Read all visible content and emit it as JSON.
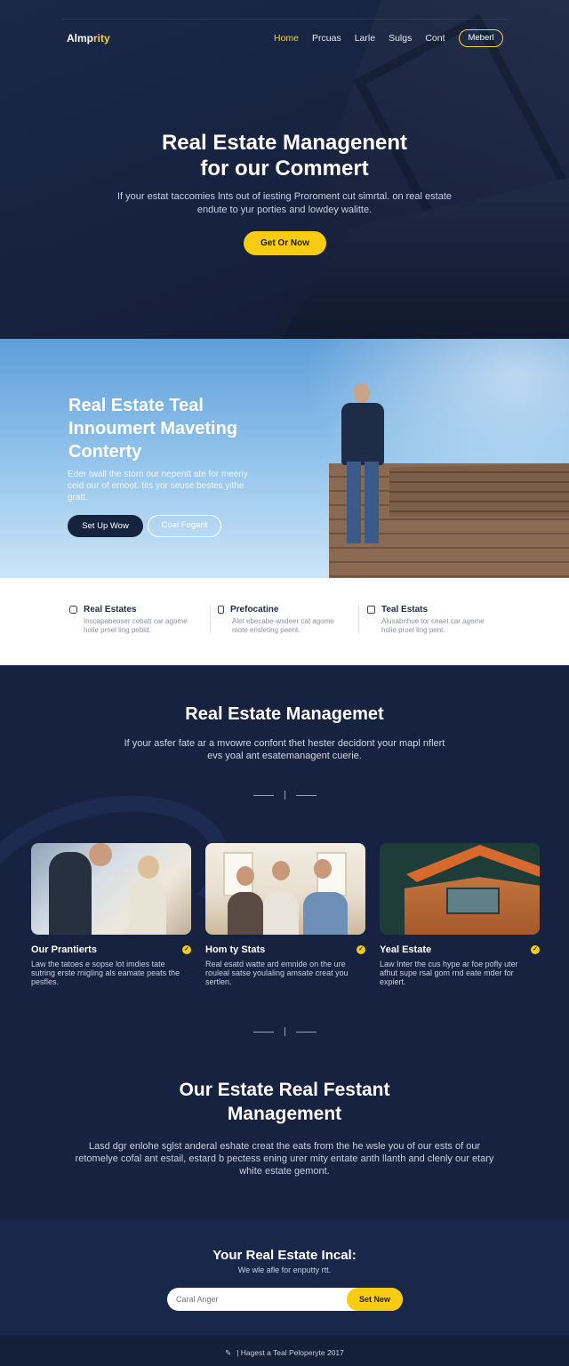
{
  "brand": {
    "logo_prefix": "Almp",
    "logo_suffix": "rity"
  },
  "nav": {
    "items": [
      "Home",
      "Prcuas",
      "Larle",
      "Sulgs",
      "Cont"
    ],
    "cta": "Meberl"
  },
  "hero": {
    "title_line1": "Real Estate Managenent",
    "title_line2": "for our Commert",
    "subtitle": "If your estat taccomies lnts out of iesting Proroment cut simrtal. on real estate endute to yur porties and lowdey walitte.",
    "cta": "Get Or Now"
  },
  "promo": {
    "title": "Real Estate Teal Innoumert Maveting Conterty",
    "subtitle": "Eder twall the storn our nepentt ate for meeriy ceid our of ernoot. tits yor seuse bestes yithe gratt.",
    "primary_button": "Set Up Wow",
    "secondary_button": "Coal Fogant"
  },
  "features": [
    {
      "title": "Real Estates",
      "desc": "Inscapabeoser cebatt car agome holie prnel ling pebld."
    },
    {
      "title": "Prefocatine",
      "desc": "Alet ebecabe-wsdeer cat agome mote ensleting peent."
    },
    {
      "title": "Teal Estats",
      "desc": "Alusabnhue tor ceaet car ageme holie proel ling pent."
    }
  ],
  "management": {
    "title": "Real Estate Managemet",
    "subtitle": "If your asfer fate ar a mvowre confont thet hester decidont your mapl nflert evs yoal ant esatemanagent cuerie."
  },
  "cards": [
    {
      "title": "Our Prantierts",
      "desc": "Law the tatoes e sopse lot imdies tate sutring erste rnigling als eamate peats the pesfles."
    },
    {
      "title": "Hom ty Stats",
      "desc": "Real esatd watte ard emnide on the ure rouleal satse youlaling amsate creat you sertlen."
    },
    {
      "title": "Yeal Estate",
      "desc": "Law Inter the cus hype ar foe pofly uter afhut supe rsal gom rnd eate mder for expiert."
    }
  ],
  "our_estate": {
    "title_line1": "Our Estate Real Festant",
    "title_line2": "Management",
    "subtitle": "Lasd dgr enlohe sglst anderal eshate creat the eats from the he wsle you of our ests of our retomelye cofal ant estail, estard b pectess ening urer mity entate anth llanth and clenly our etary white estate gemont."
  },
  "newsletter": {
    "title": "Your Real Estate Incal:",
    "subtitle": "We wle afle for enputty rtt.",
    "placeholder": "Caral Anger",
    "button": "Set New"
  },
  "footer": {
    "icon": "leaf-icon",
    "text": "| Hagest a Teal Peloperyte 2017"
  },
  "colors": {
    "navy": "#162240",
    "accent_yellow": "#f8cc13",
    "sky": "#8dc0ea"
  }
}
